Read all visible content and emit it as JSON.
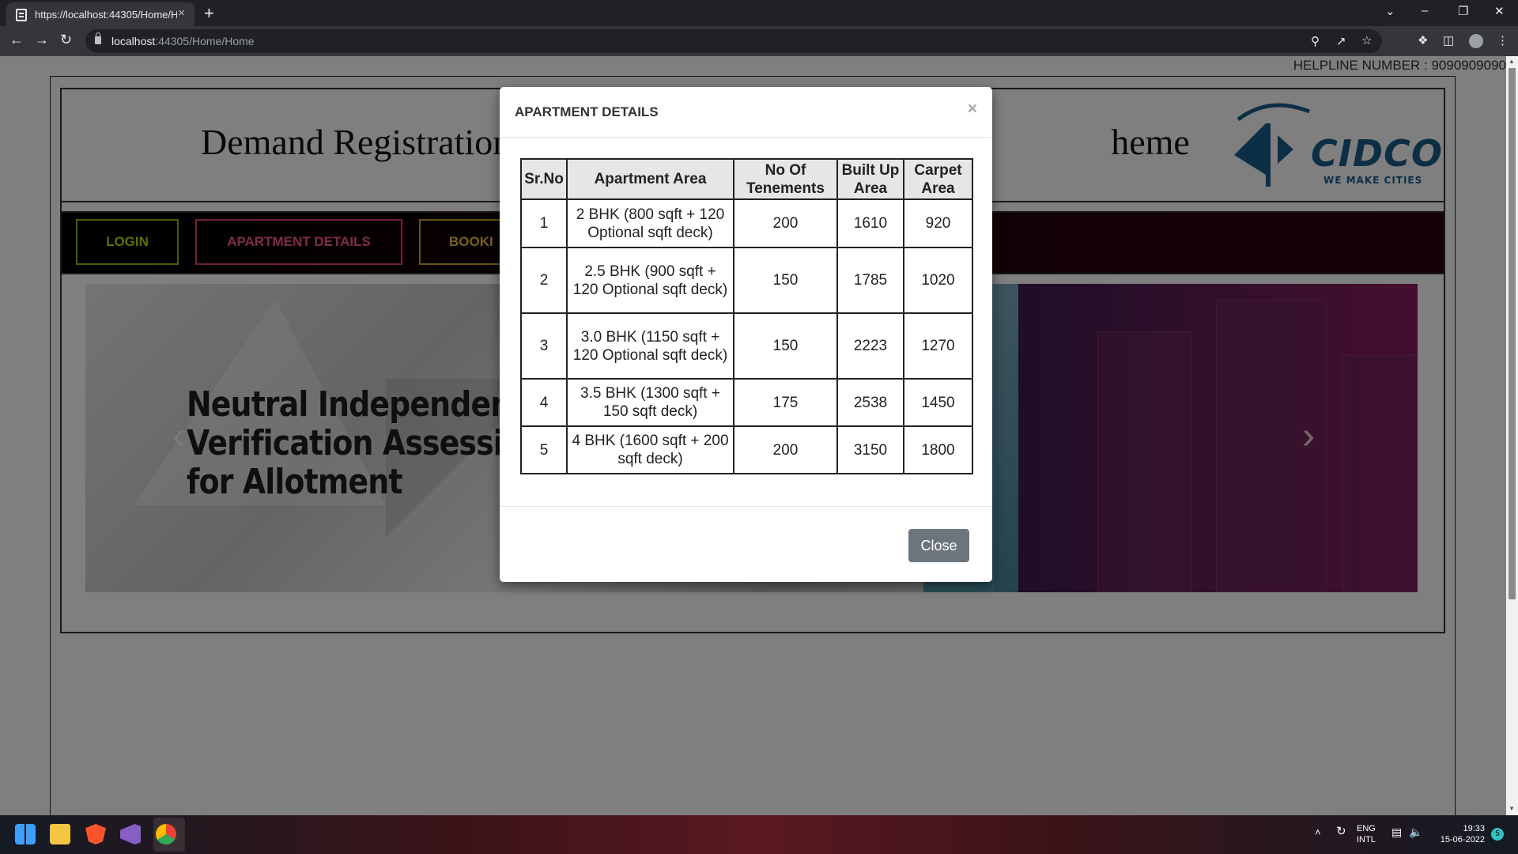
{
  "browser": {
    "tab_title": "https://localhost:44305/Home/H",
    "tab_close": "×",
    "new_tab": "+",
    "url_host": "localhost",
    "url_rest": ":44305/Home/Home",
    "window_controls": [
      "⌄",
      "–",
      "❐",
      "✕"
    ]
  },
  "page": {
    "helpline": "HELPLINE NUMBER : 9090909090",
    "site_title": "Demand Registration                                                                  heme",
    "logo_text": "CIDCO",
    "logo_tagline": "WE MAKE CITIES",
    "nav": {
      "login": "LOGIN",
      "apartment_details": "APARTMENT DETAILS",
      "booking": "BOOKI"
    },
    "slide_lines": [
      "Neutral Independen",
      "Verification Assessi",
      "for Allotment"
    ],
    "carousel_prev": "‹",
    "carousel_next": "›"
  },
  "modal": {
    "title": "APARTMENT DETAILS",
    "close_x": "×",
    "close_button": "Close",
    "table": {
      "headers": [
        "Sr.No",
        "Apartment Area",
        "No Of Tenements",
        "Built Up Area",
        "Carpet Area"
      ],
      "rows": [
        [
          "1",
          "2 BHK (800 sqft + 120 Optional sqft deck)",
          "200",
          "1610",
          "920"
        ],
        [
          "2",
          "2.5 BHK (900 sqft + 120 Optional sqft deck)",
          "150",
          "1785",
          "1020"
        ],
        [
          "3",
          "3.0 BHK (1150 sqft + 120 Optional sqft deck)",
          "150",
          "2223",
          "1270"
        ],
        [
          "4",
          "3.5 BHK (1300 sqft + 150 sqft deck)",
          "175",
          "2538",
          "1450"
        ],
        [
          "5",
          "4 BHK (1600 sqft + 200 sqft deck)",
          "200",
          "3150",
          "1800"
        ]
      ]
    }
  },
  "taskbar": {
    "lang_top": "ENG",
    "lang_bottom": "INTL",
    "time": "19:33",
    "date": "15-06-2022",
    "notification_count": "5"
  },
  "colors": {
    "modal_button": "#6c757d",
    "nav_login": "#b8e000",
    "nav_apartment": "#ff5a8a",
    "nav_booking": "#e8c040",
    "logo_blue": "#1b5e8a"
  }
}
